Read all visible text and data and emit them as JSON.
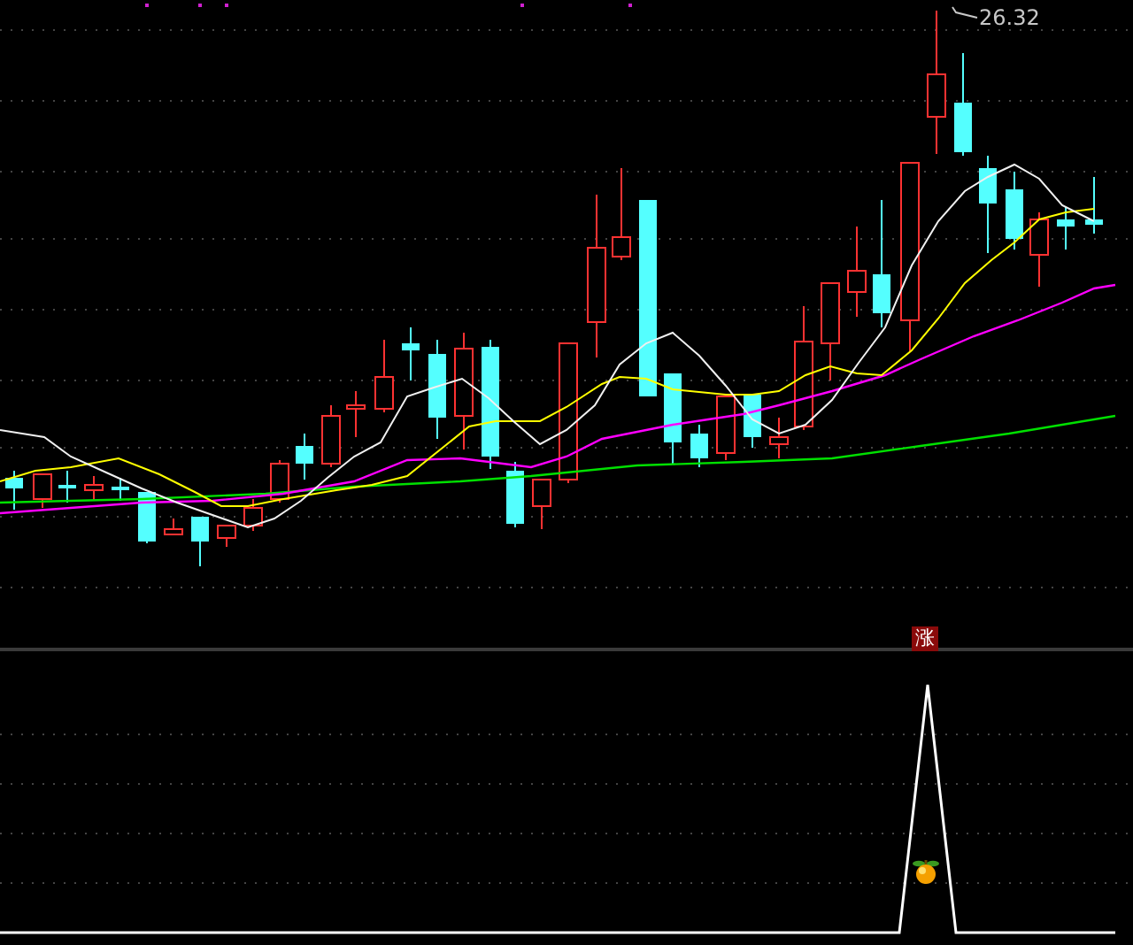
{
  "price_chart": {
    "high_label": "26.32"
  },
  "signal_panel": {
    "marker": "涨"
  }
}
